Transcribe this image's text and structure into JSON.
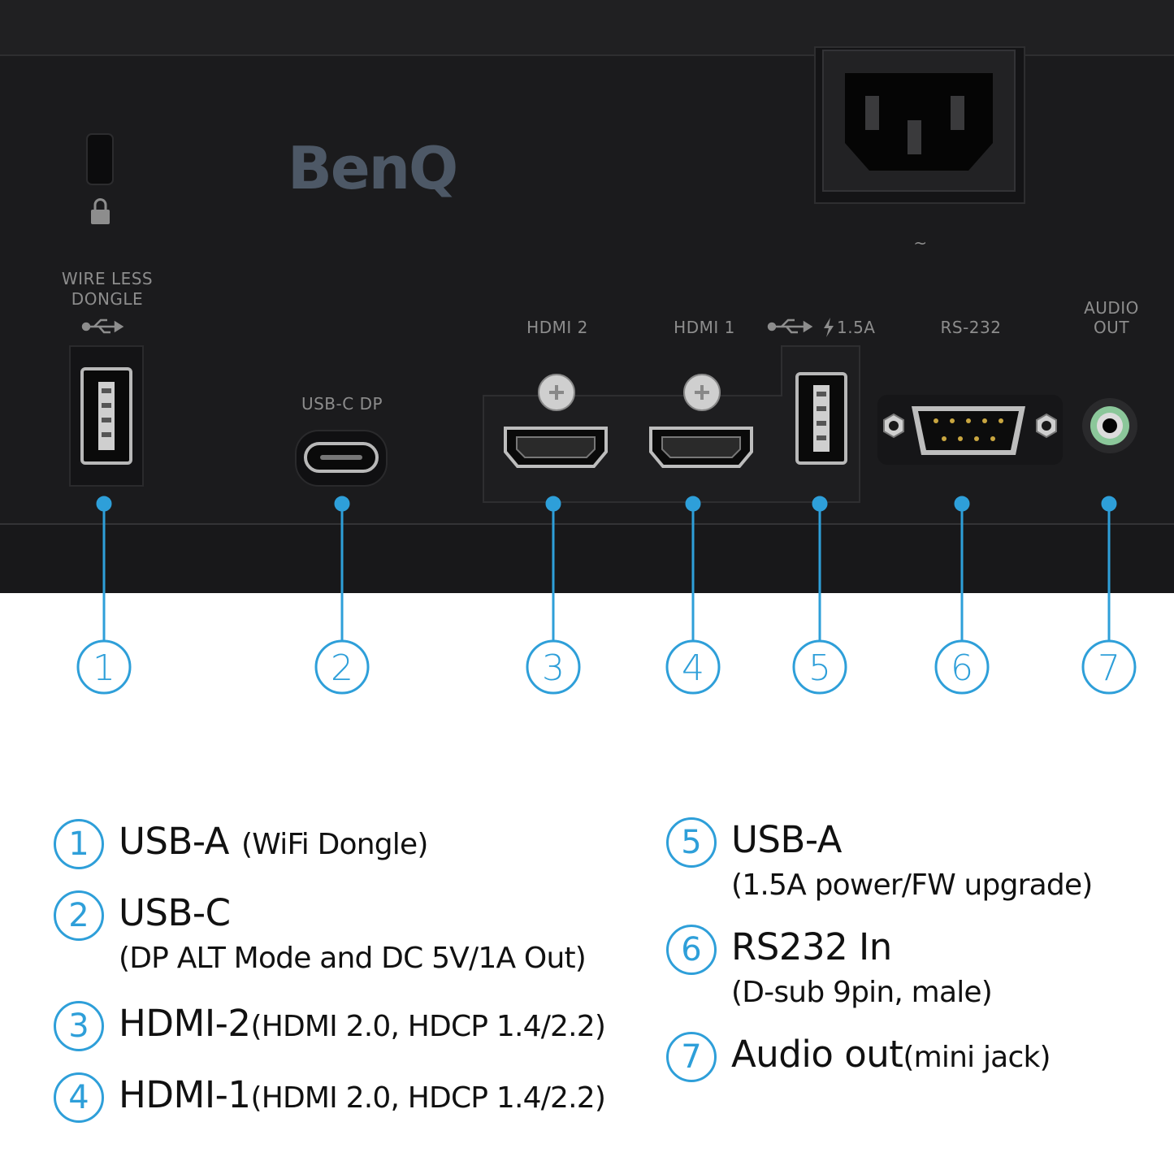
{
  "brand": "BenQ",
  "port_labels": {
    "wireless_line1": "WIRE LESS",
    "wireless_line2": "DONGLE",
    "usbc": "USB-C DP",
    "hdmi2": "HDMI 2",
    "hdmi1": "HDMI 1",
    "usb_power": "1.5A",
    "rs232": "RS-232",
    "audio_line1": "AUDIO",
    "audio_line2": "OUT",
    "ac_symbol": "~"
  },
  "callout_numbers": [
    "1",
    "2",
    "3",
    "4",
    "5",
    "6",
    "7"
  ],
  "legend": [
    {
      "num": "1",
      "title": "USB-A",
      "detail": "(WiFi Dongle)",
      "detail_inline": true
    },
    {
      "num": "2",
      "title": "USB-C",
      "detail": "(DP ALT Mode and DC 5V/1A Out)",
      "detail_inline": false
    },
    {
      "num": "3",
      "title": "HDMI-2",
      "detail": "(HDMI 2.0, HDCP 1.4/2.2)",
      "detail_inline": true
    },
    {
      "num": "4",
      "title": "HDMI-1",
      "detail": "(HDMI 2.0, HDCP 1.4/2.2)",
      "detail_inline": true
    },
    {
      "num": "5",
      "title": "USB-A",
      "detail": "(1.5A power/FW upgrade)",
      "detail_inline": false
    },
    {
      "num": "6",
      "title": "RS232 In",
      "detail": "(D-sub 9pin, male)",
      "detail_inline": false
    },
    {
      "num": "7",
      "title": "Audio out",
      "detail": "(mini jack)",
      "detail_inline": true
    }
  ],
  "colors": {
    "accent": "#2e9fd9",
    "panel": "#1c1c1e",
    "label": "#8d8d8d"
  }
}
